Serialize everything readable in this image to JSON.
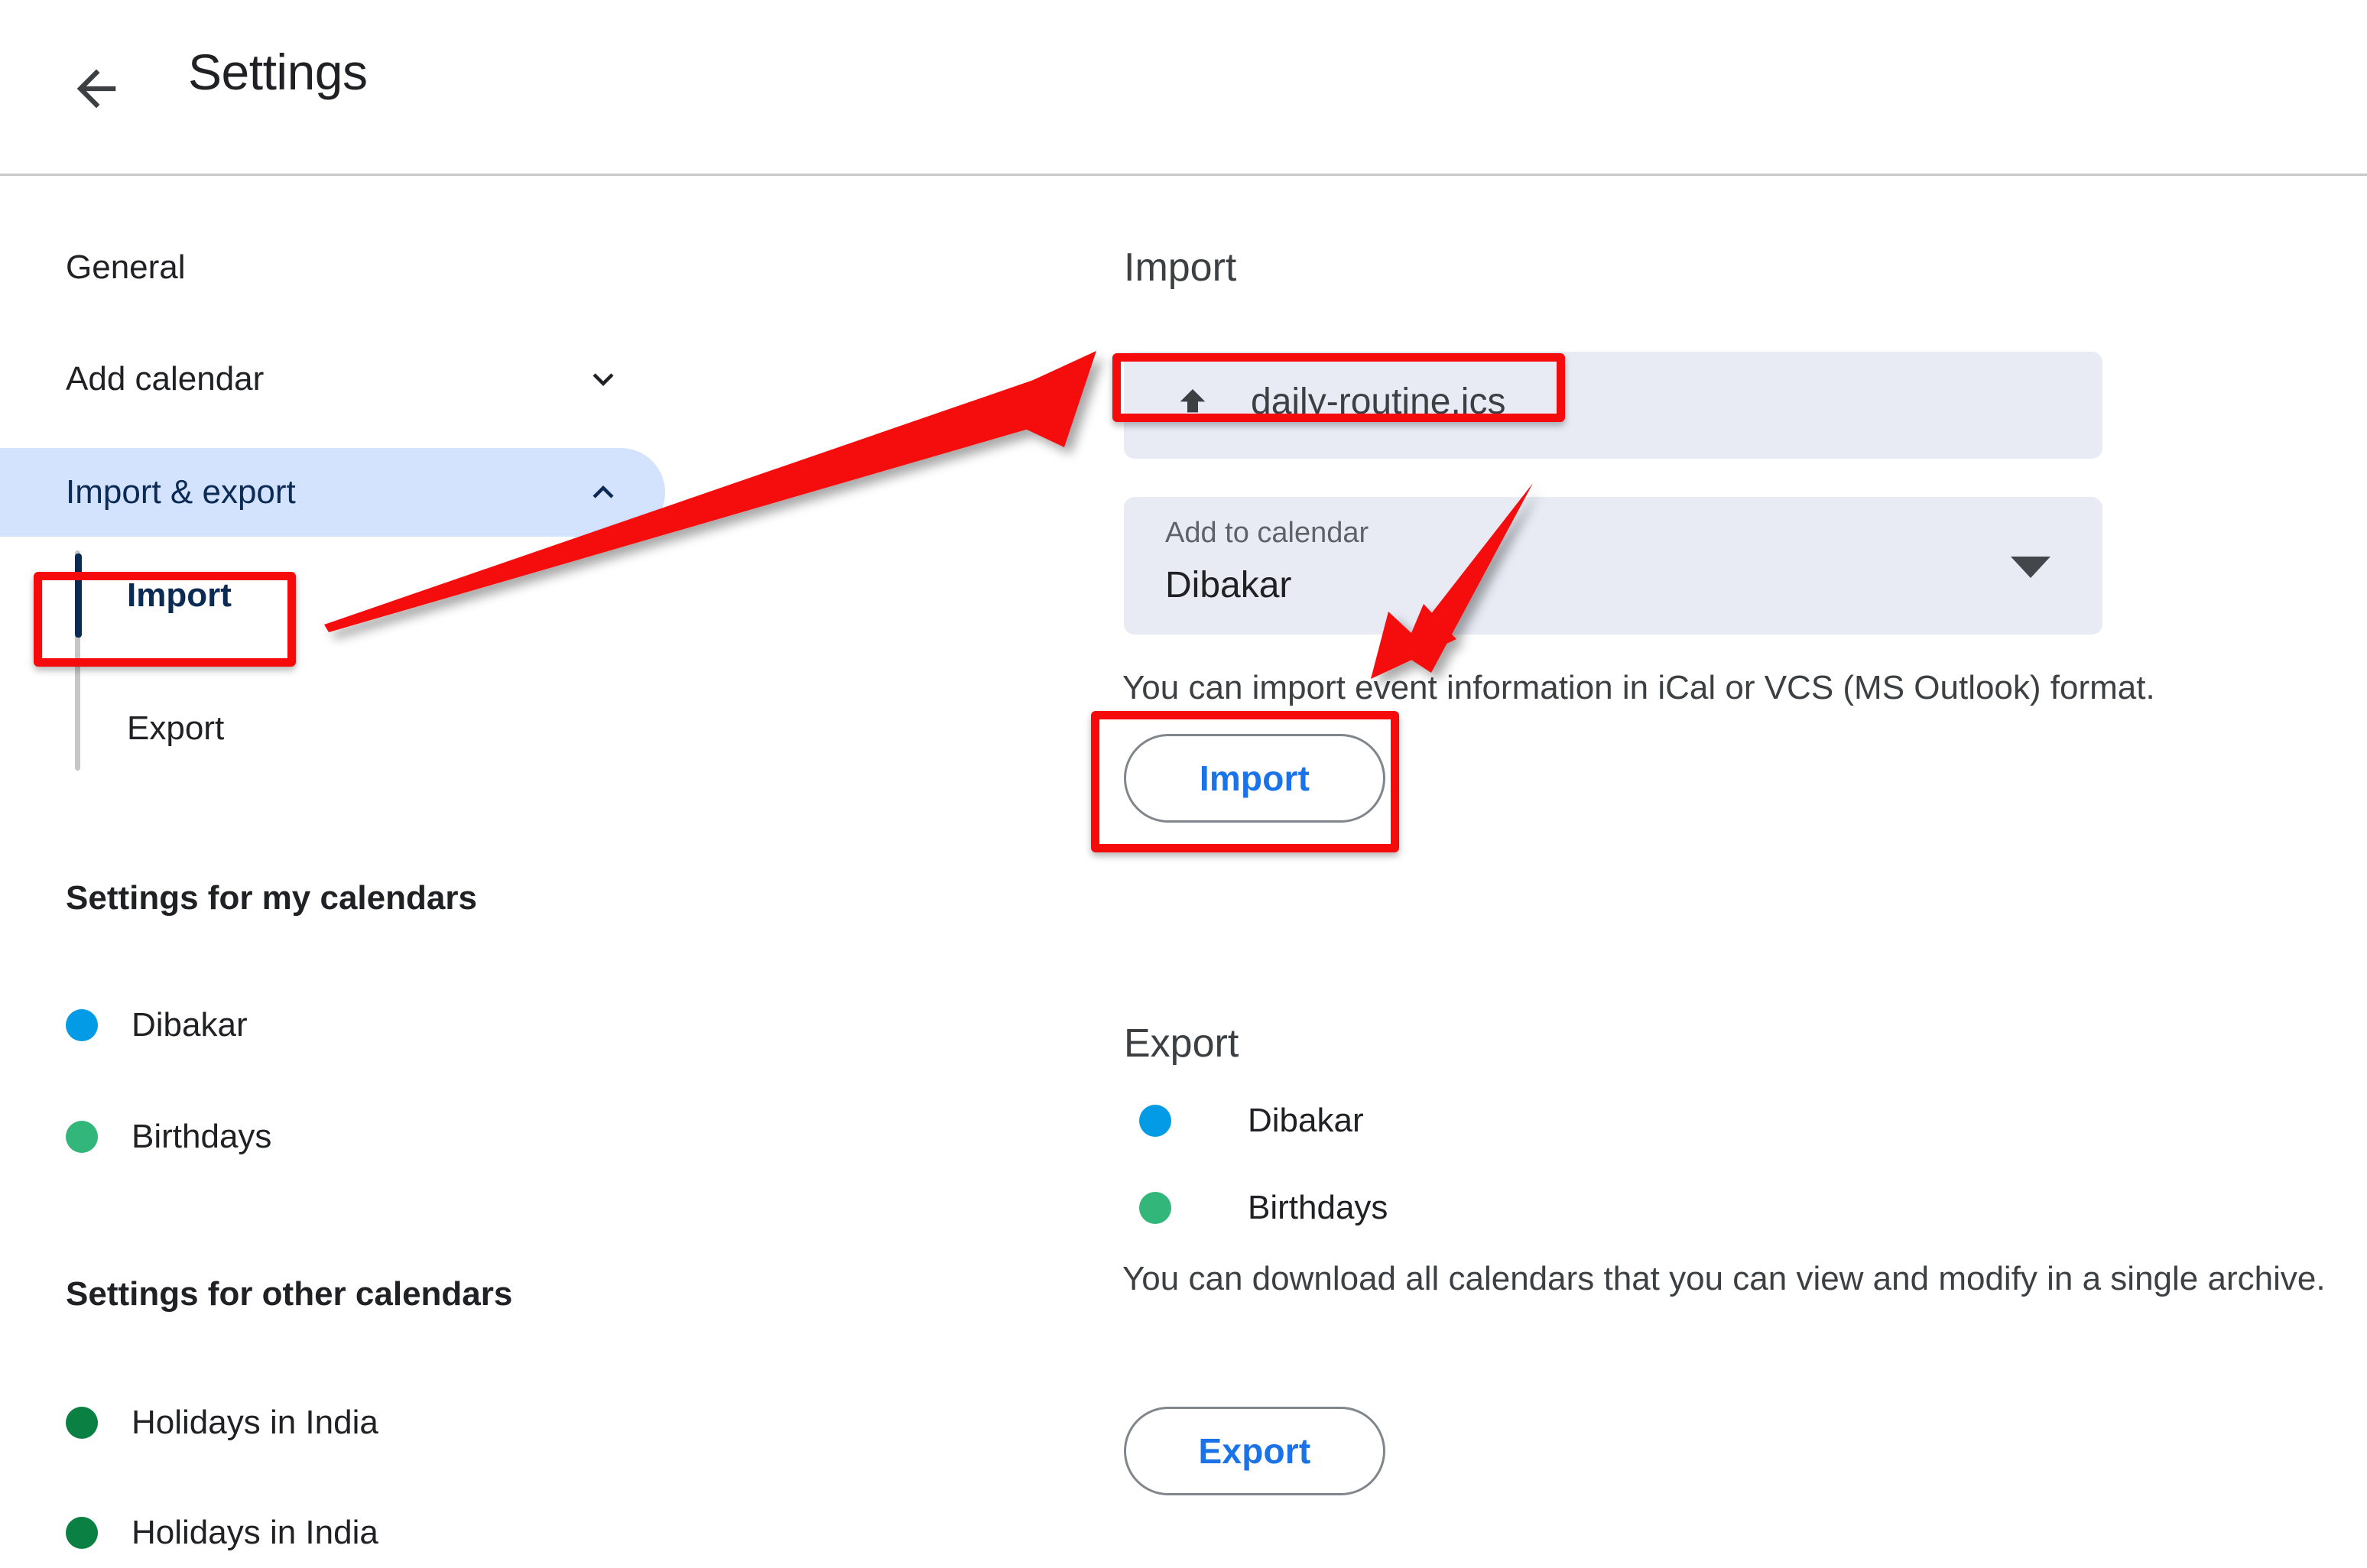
{
  "header": {
    "title": "Settings",
    "back_icon": "arrow-left-icon"
  },
  "sidebar": {
    "nav": [
      {
        "label": "General",
        "chevron": null
      },
      {
        "label": "Add calendar",
        "chevron": "chevron-down-icon"
      },
      {
        "label": "Import & export",
        "chevron": "chevron-up-icon",
        "active": true
      }
    ],
    "subnav": [
      {
        "label": "Import",
        "active": true
      },
      {
        "label": "Export",
        "active": false
      }
    ],
    "my_calendars_heading": "Settings for my calendars",
    "my_calendars": [
      {
        "name": "Dibakar",
        "color": "#039BE5"
      },
      {
        "name": "Birthdays",
        "color": "#33B679"
      }
    ],
    "other_calendars_heading": "Settings for other calendars",
    "other_calendars": [
      {
        "name": "Holidays in India",
        "color": "#0B8043"
      },
      {
        "name": "Holidays in India",
        "color": "#0B8043"
      }
    ]
  },
  "main": {
    "import": {
      "heading": "Import",
      "file_icon": "file-upload-icon",
      "file_name": "daily-routine.ics",
      "add_to_calendar_label": "Add to calendar",
      "add_to_calendar_value": "Dibakar",
      "dropdown_icon": "caret-down-icon",
      "help_text": "You can import event information in iCal or VCS (MS Outlook) format.",
      "button_label": "Import"
    },
    "export": {
      "heading": "Export",
      "calendars": [
        {
          "name": "Dibakar",
          "color": "#039BE5"
        },
        {
          "name": "Birthdays",
          "color": "#33B679"
        }
      ],
      "help_text": "You can download all calendars that you can view and modify in a single archive.",
      "button_label": "Export"
    }
  },
  "annotations": {
    "highlight_color": "#F50B0B",
    "boxes": [
      {
        "target": "sidebar-import-item"
      },
      {
        "target": "file-upload-field"
      },
      {
        "target": "import-button"
      }
    ],
    "arrows": [
      {
        "from": "sidebar-import-item",
        "to": "file-upload-field"
      },
      {
        "from": "add-to-calendar-field",
        "to": "import-help-text"
      }
    ]
  },
  "colors": {
    "active_nav_pill": "#D3E3FD",
    "active_nav_text": "#0B2B55",
    "field_background": "#E8EBF4",
    "link_blue": "#1A73E8"
  }
}
